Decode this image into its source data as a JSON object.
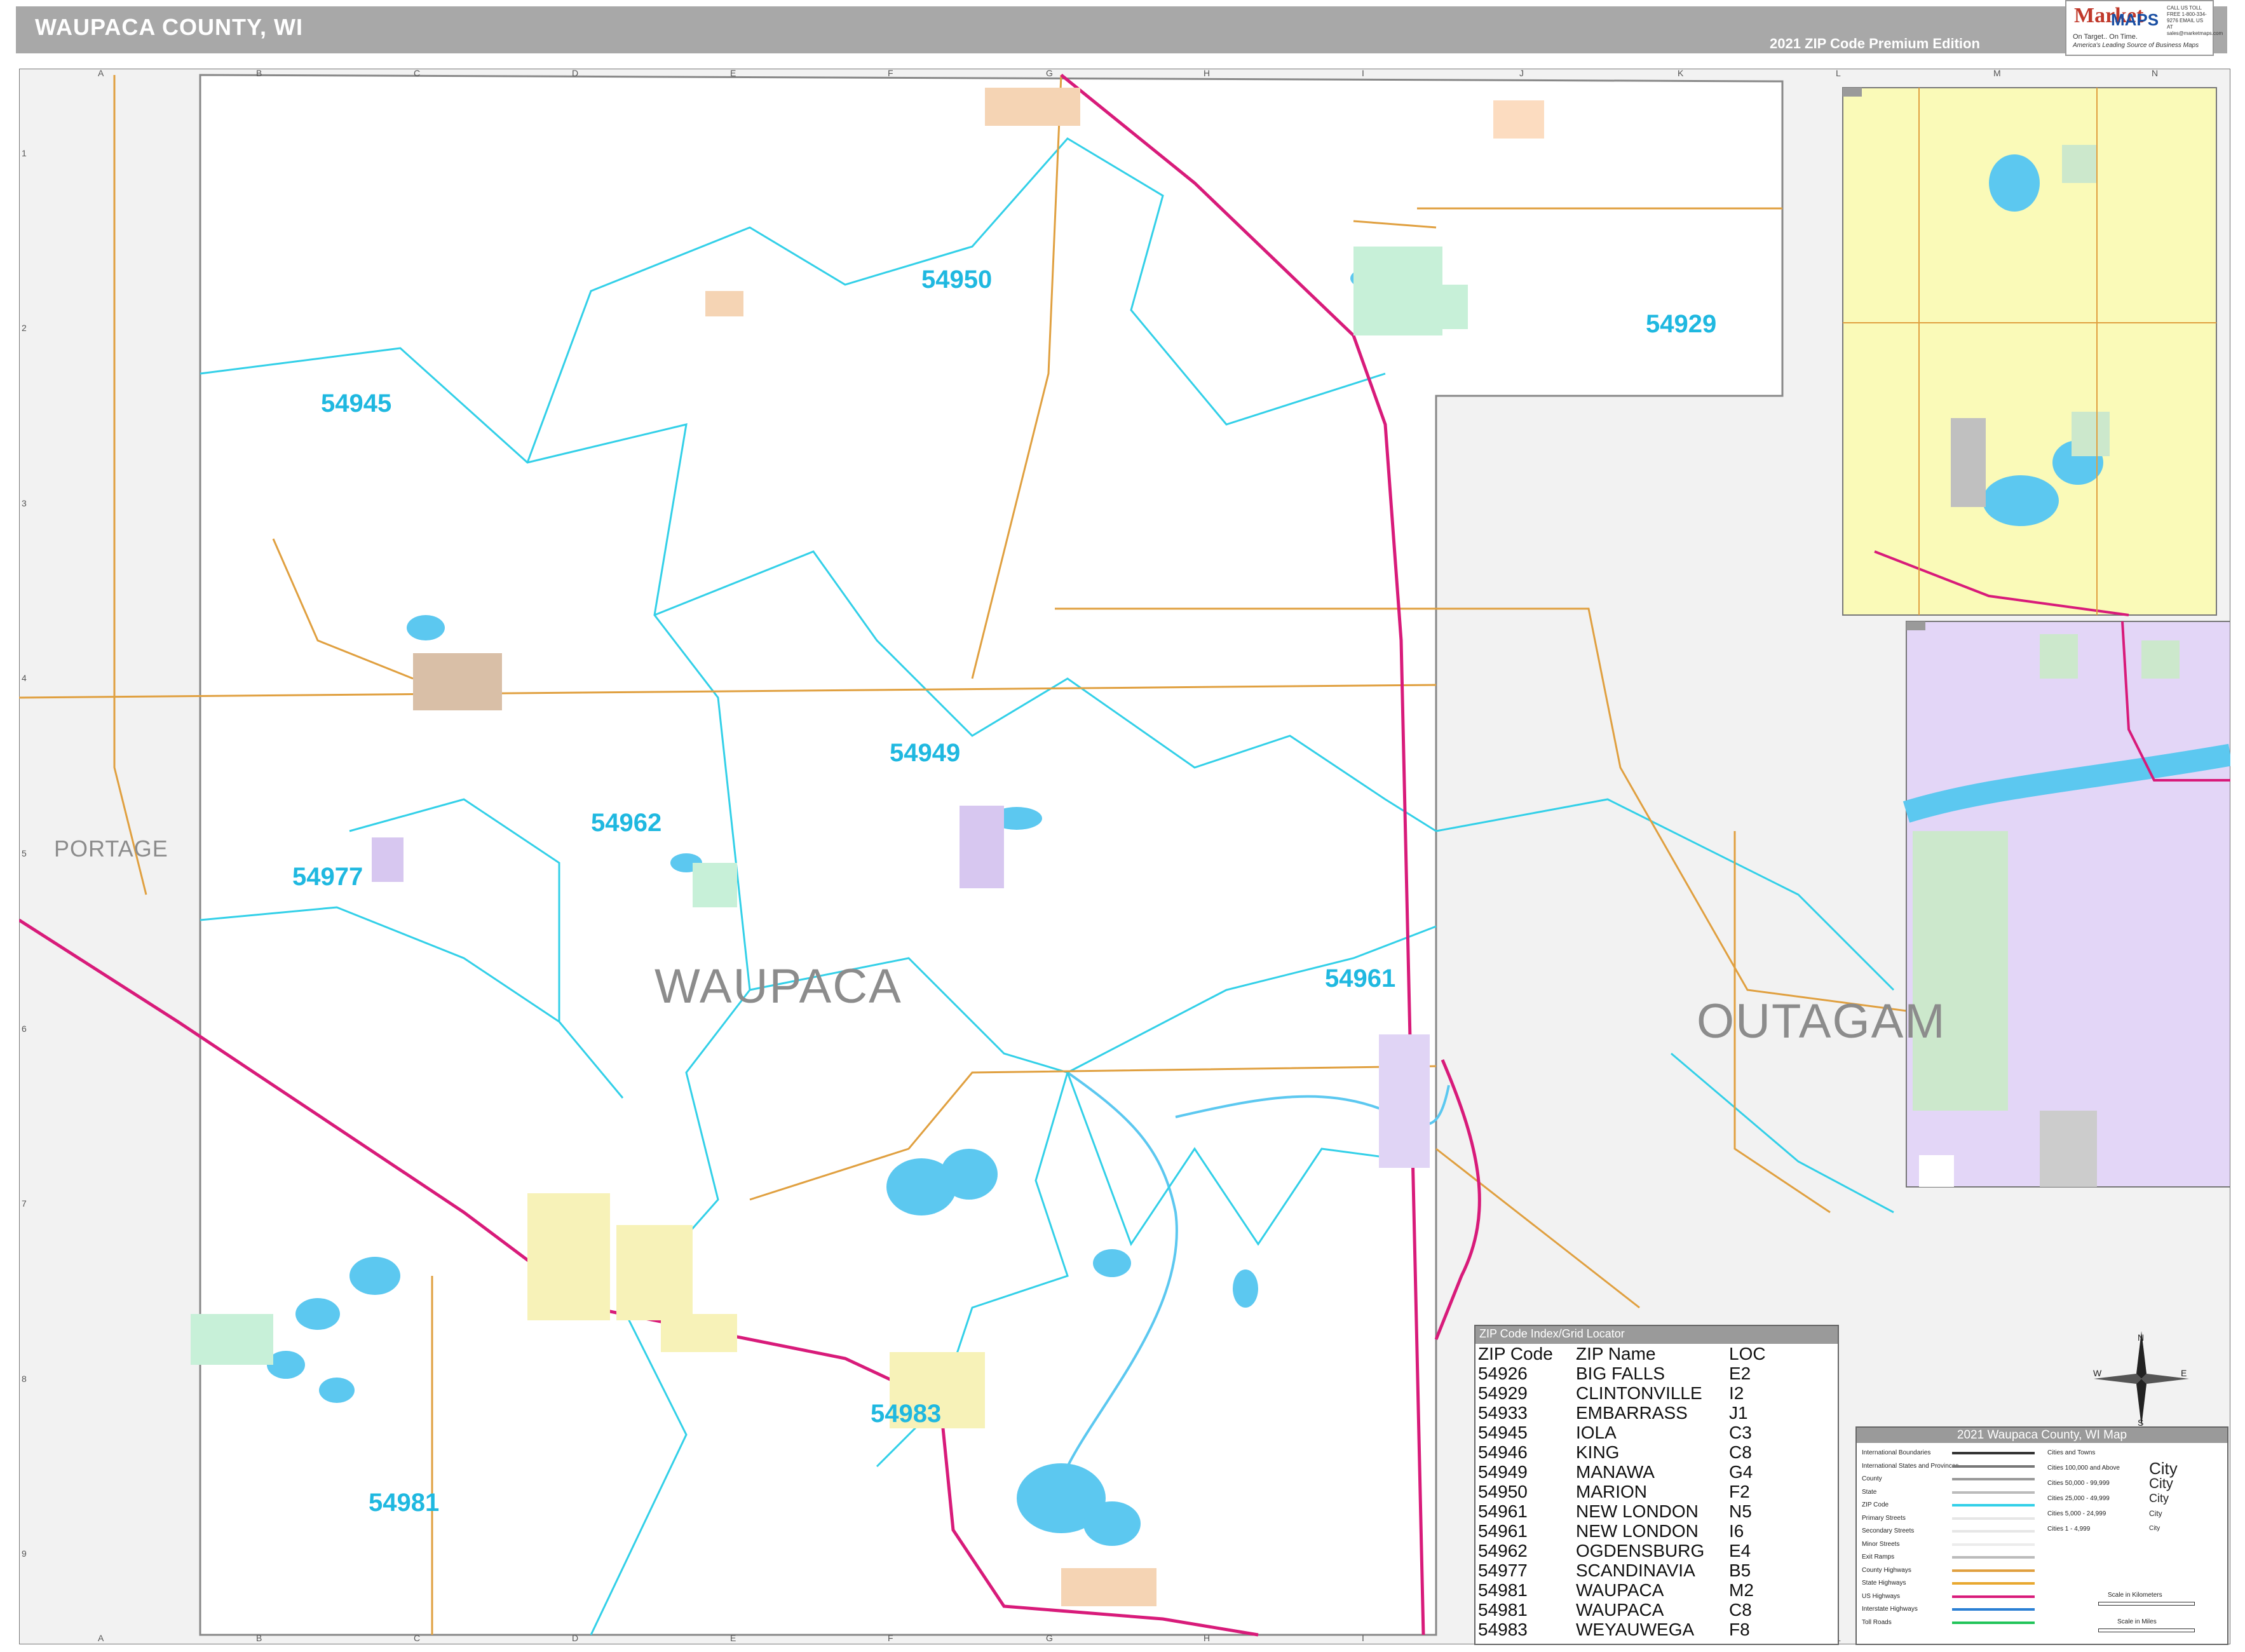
{
  "header": {
    "title": "WAUPACA COUNTY, WI",
    "edition": "2021 ZIP Code Premium Edition"
  },
  "logo": {
    "brand_a": "Market",
    "brand_b": "MAPS",
    "tagline": "On Target.. On Time.",
    "tagline2": "America's Leading Source of Business Maps",
    "contact": "CALL US TOLL FREE 1-800-334-9276 EMAIL US AT sales@marketmaps.com"
  },
  "grid": {
    "columns": [
      "A",
      "B",
      "C",
      "D",
      "E",
      "F",
      "G",
      "H",
      "I",
      "J",
      "K",
      "L",
      "M",
      "N"
    ],
    "rows": [
      "1",
      "2",
      "3",
      "4",
      "5",
      "6",
      "7",
      "8",
      "9"
    ]
  },
  "map": {
    "county_labels": {
      "main": "WAUPACA",
      "east": "OUTAGAM",
      "west": "PORTAGE"
    },
    "zip_labels": [
      "54950",
      "54929",
      "54945",
      "54949",
      "54962",
      "54977",
      "54961",
      "54983",
      "54981"
    ],
    "colors": {
      "zip_boundary": "#33d0e8",
      "county_road": "#e0a040",
      "us_highway": "#d81b7a",
      "water": "#5cc8f0",
      "outside_county": "#f0f0f0"
    }
  },
  "index": {
    "title": "ZIP Code Index/Grid Locator",
    "columns": [
      "ZIP Code",
      "ZIP Name",
      "LOC"
    ],
    "rows": [
      [
        "54926",
        "BIG FALLS",
        "E2"
      ],
      [
        "54929",
        "CLINTONVILLE",
        "I2"
      ],
      [
        "54933",
        "EMBARRASS",
        "J1"
      ],
      [
        "54945",
        "IOLA",
        "C3"
      ],
      [
        "54946",
        "KING",
        "C8"
      ],
      [
        "54949",
        "MANAWA",
        "G4"
      ],
      [
        "54950",
        "MARION",
        "F2"
      ],
      [
        "54961",
        "NEW LONDON",
        "N5"
      ],
      [
        "54961",
        "NEW LONDON",
        "I6"
      ],
      [
        "54962",
        "OGDENSBURG",
        "E4"
      ],
      [
        "54977",
        "SCANDINAVIA",
        "B5"
      ],
      [
        "54981",
        "WAUPACA",
        "M2"
      ],
      [
        "54981",
        "WAUPACA",
        "C8"
      ],
      [
        "54983",
        "WEYAUWEGA",
        "F8"
      ]
    ]
  },
  "legend": {
    "title": "2021 Waupaca County, WI Map",
    "left": [
      "International Boundaries",
      "International States and Provinces",
      "County",
      "State",
      "ZIP Code",
      "Primary Streets",
      "Secondary Streets",
      "Minor Streets",
      "Exit Ramps",
      "County Highways",
      "State Highways",
      "US Highways",
      "Interstate Highways",
      "Toll Roads"
    ],
    "right": [
      "Cities and Towns",
      "Cities 100,000 and Above",
      "Cities 50,000 - 99,999",
      "Cities 25,000 - 49,999",
      "Cities 5,000 - 24,999",
      "Cities 1 - 4,999"
    ],
    "city_samples": [
      "City",
      "City",
      "City",
      "City",
      "City"
    ],
    "scale_km": "Scale in Kilometers",
    "scale_mi": "Scale in Miles"
  },
  "compass": {
    "n": "N",
    "s": "S",
    "e": "E",
    "w": "W"
  }
}
